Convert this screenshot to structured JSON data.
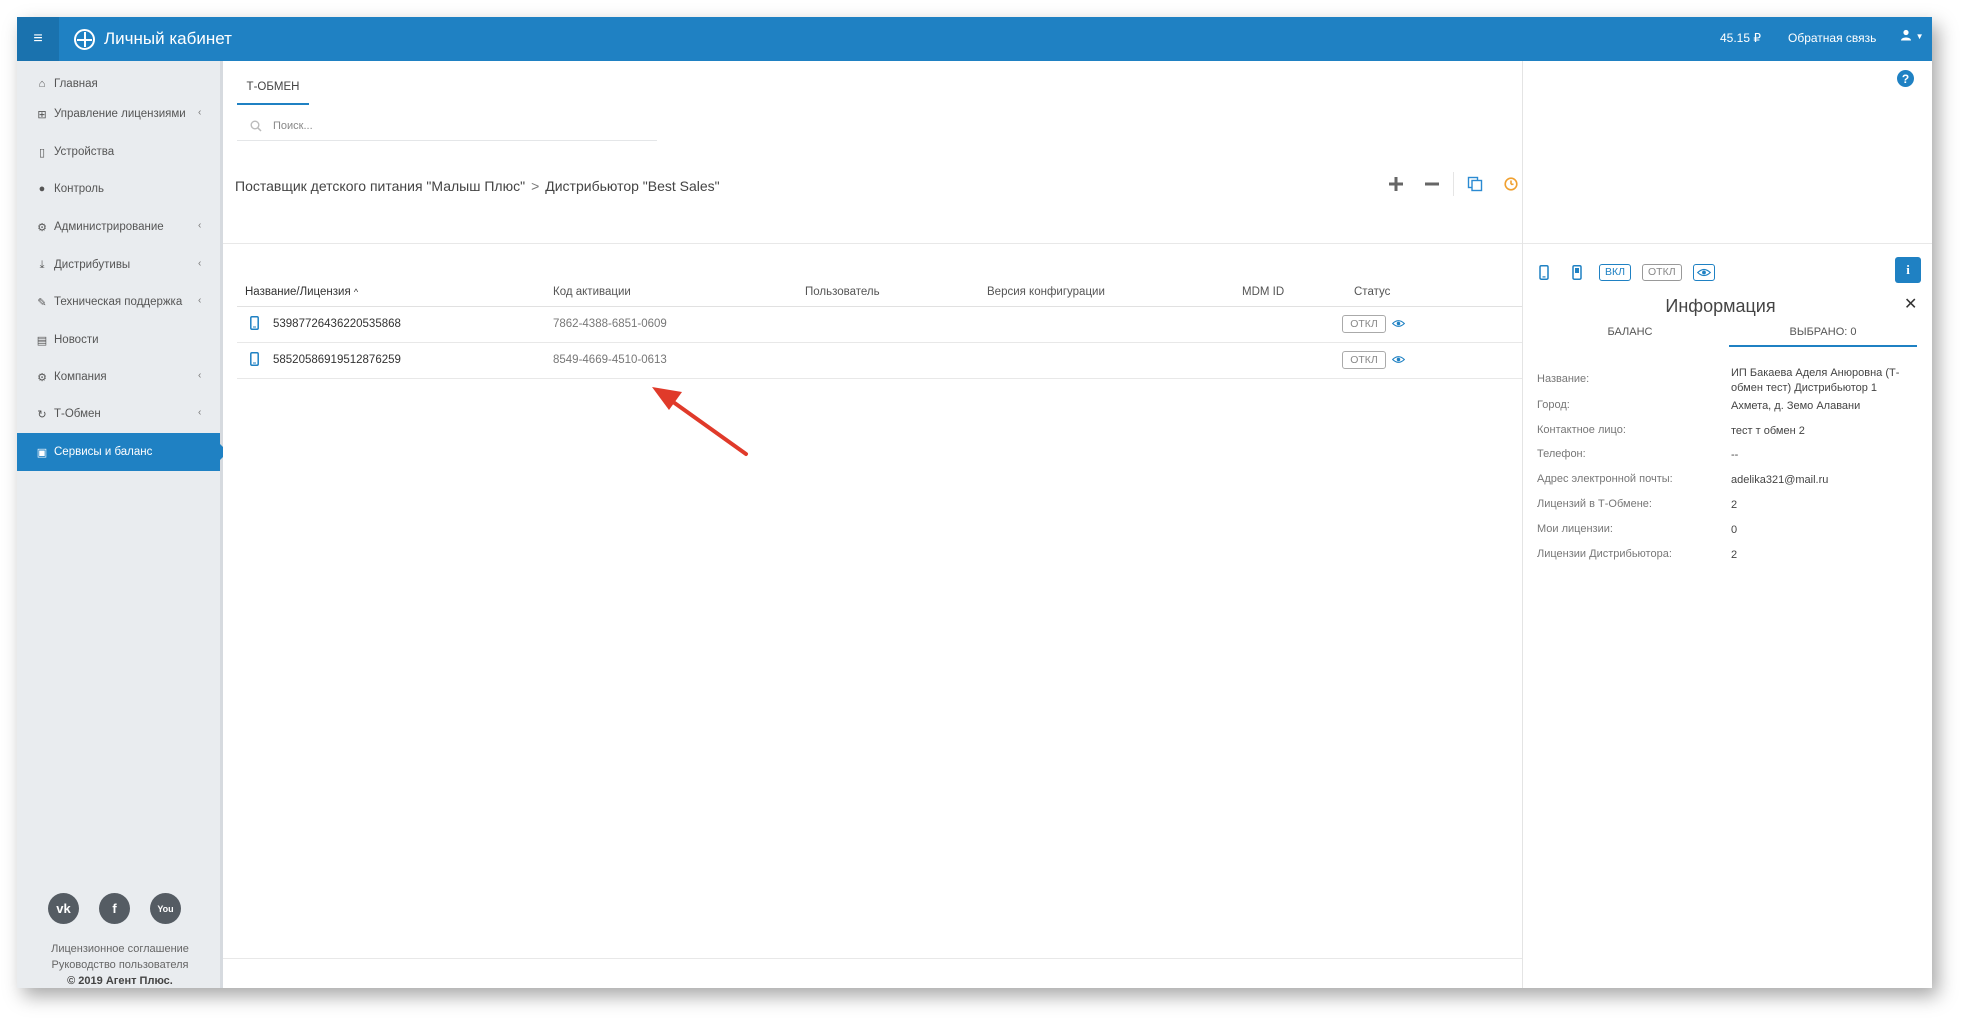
{
  "header": {
    "title": "Личный кабинет",
    "balance": "45.15 ₽",
    "feedback": "Обратная связь"
  },
  "sidebar": {
    "items": [
      {
        "label": "Главная",
        "icon": "home-icon",
        "glyph": "⌂",
        "chevron": false,
        "active": false
      },
      {
        "label": "Управление лицензиями",
        "icon": "sitemap-icon",
        "glyph": "⊞",
        "chevron": true,
        "active": false
      },
      {
        "label": "Устройства",
        "icon": "mobile-icon",
        "glyph": "▯",
        "chevron": false,
        "active": false
      },
      {
        "label": "Контроль",
        "icon": "globe-icon",
        "glyph": "●",
        "chevron": false,
        "active": false
      },
      {
        "label": "Администрирование",
        "icon": "cogs-icon",
        "glyph": "⚙",
        "chevron": true,
        "active": false
      },
      {
        "label": "Дистрибутивы",
        "icon": "download-icon",
        "glyph": "⤓",
        "chevron": true,
        "active": false
      },
      {
        "label": "Техническая поддержка",
        "icon": "wrench-icon",
        "glyph": "✎",
        "chevron": true,
        "active": false
      },
      {
        "label": "Новости",
        "icon": "newspaper-icon",
        "glyph": "▤",
        "chevron": false,
        "active": false
      },
      {
        "label": "Компания",
        "icon": "gear-icon",
        "glyph": "⚙",
        "chevron": true,
        "active": false
      },
      {
        "label": "Т-Обмен",
        "icon": "refresh-icon",
        "glyph": "↻",
        "chevron": true,
        "active": false
      },
      {
        "label": "Сервисы и баланс",
        "icon": "money-icon",
        "glyph": "▣",
        "chevron": false,
        "active": true
      }
    ],
    "social": [
      {
        "name": "vk-icon",
        "glyph": "vk"
      },
      {
        "name": "facebook-icon",
        "glyph": "f"
      },
      {
        "name": "youtube-icon",
        "glyph": "You"
      }
    ],
    "footer": {
      "license": "Лицензионное соглашение",
      "manual": "Руководство пользователя",
      "copyright": "© 2019 Агент Плюс."
    }
  },
  "main": {
    "tab": "Т-ОБМЕН",
    "search_placeholder": "Поиск...",
    "breadcrumb": {
      "supplier": "Поставщик детского питания \"Малыш Плюс\"",
      "separator": ">",
      "distributor": "Дистрибьютор \"Best Sales\""
    },
    "table": {
      "columns": [
        "Название/Лицензия",
        "Код активации",
        "Пользователь",
        "Версия конфигурации",
        "MDM ID",
        "Статус"
      ],
      "sort_indicator": "^",
      "rows": [
        {
          "license": "53987726436220535868",
          "code": "7862-4388-6851-0609",
          "user": "",
          "version": "",
          "mdm": "",
          "status": "ОТКЛ"
        },
        {
          "license": "58520586919512876259",
          "code": "8549-4669-4510-0613",
          "user": "",
          "version": "",
          "mdm": "",
          "status": "ОТКЛ"
        }
      ]
    }
  },
  "panel": {
    "help": "?",
    "badge_on": "ВКЛ",
    "badge_off": "ОТКЛ",
    "title": "Информация",
    "tabs": [
      "БАЛАНС",
      "ВЫБРАНО: 0"
    ],
    "fields": [
      {
        "label": "Название:",
        "value": "ИП Бакаева Аделя Анюровна (Т-обмен тест) Дистрибьютор 1"
      },
      {
        "label": "Город:",
        "value": "Ахмета, д. Земо Алавани"
      },
      {
        "label": "Контактное лицо:",
        "value": "тест т обмен 2"
      },
      {
        "label": "Телефон:",
        "value": "--"
      },
      {
        "label": "Адрес электронной почты:",
        "value": "adelika321@mail.ru"
      },
      {
        "label": "Лицензий в Т-Обмене:",
        "value": "2"
      },
      {
        "label": "Мои лицензии:",
        "value": "0"
      },
      {
        "label": "Лицензии Дистрибьютора:",
        "value": "2"
      }
    ]
  },
  "colors": {
    "brand": "#1f81c3",
    "accent_orange": "#f0a030",
    "annotation_red": "#e03a2a"
  }
}
